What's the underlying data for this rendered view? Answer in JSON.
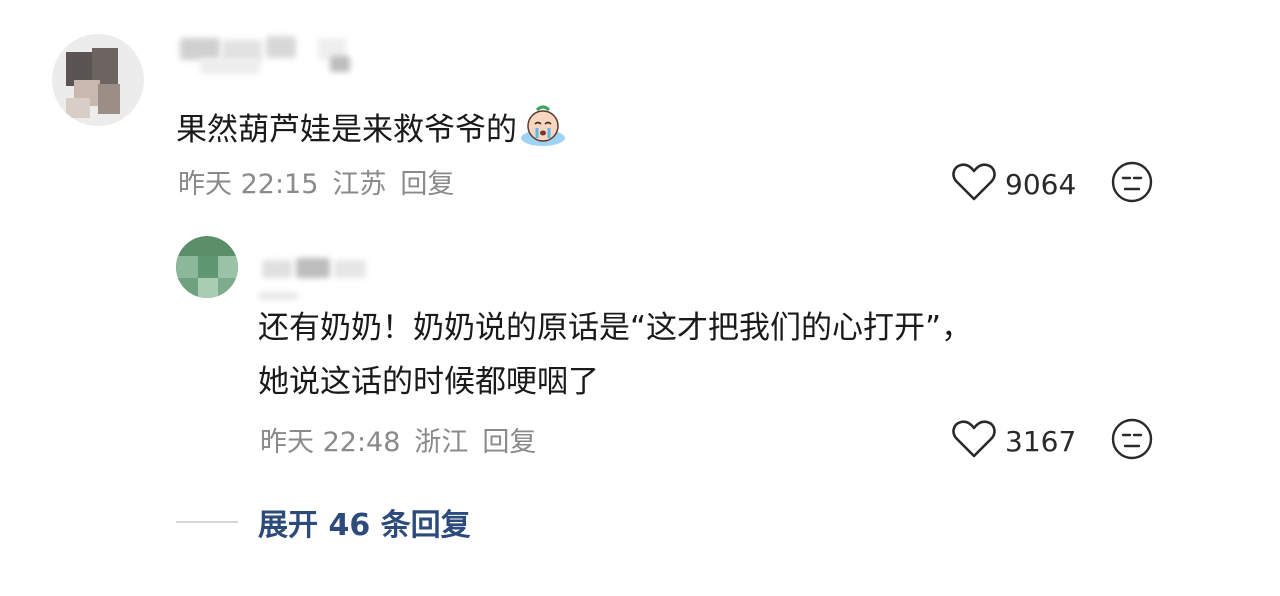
{
  "comments": [
    {
      "text": "果然葫芦娃是来救爷爷的",
      "emoji": "crying-face-emoji",
      "time": "昨天 22:15",
      "location": "江苏",
      "reply_label": "回复",
      "likes": "9064"
    },
    {
      "text_line1": "还有奶奶！奶奶说的原话是“这才把我们的心打开”，",
      "text_line2": "她说这话的时候都哽咽了",
      "time": "昨天 22:48",
      "location": "浙江",
      "reply_label": "回复",
      "likes": "3167"
    }
  ],
  "expand_replies": "展开 46 条回复",
  "icons": {
    "like": "heart-outline-icon",
    "dislike": "neutral-face-icon"
  },
  "colors": {
    "link": "#2c4a7a",
    "meta": "#8a8a8a",
    "text": "#1a1a1a"
  }
}
